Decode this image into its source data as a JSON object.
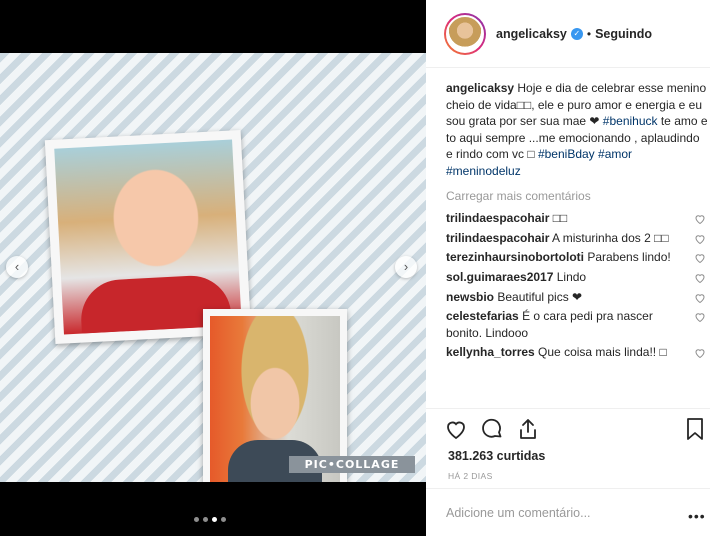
{
  "post": {
    "username": "angelicaksy",
    "verified": true,
    "follow_separator": "•",
    "follow_status": "Seguindo",
    "caption_text_before_tag": " Hoje e dia de celebrar esse menino cheio de vida□□, ele e puro amor e energia e eu sou grata por ser sua mae ❤ ",
    "caption_tag1": "#benihuck",
    "caption_mid": " te amo e to aqui sempre ...me emocionando , aplaudindo e rindo com vc □ ",
    "caption_tag2": "#beniBday",
    "caption_tag3": "#amor",
    "caption_tag4": "#meninodeluz",
    "load_more": "Carregar mais comentários",
    "likes": "381.263 curtidas",
    "time_ago": "HÁ 2 DIAS",
    "add_comment_placeholder": "Adicione um comentário...",
    "more_options": "•••"
  },
  "comments": [
    {
      "user": "trilindaespacohair",
      "text": " □□"
    },
    {
      "user": "trilindaespacohair",
      "text": " A misturinha dos 2 □□"
    },
    {
      "user": "terezinhaursinobortoloti",
      "text": " Parabens lindo!"
    },
    {
      "user": "sol.guimaraes2017",
      "text": " Lindo"
    },
    {
      "user": "newsbio",
      "text": " Beautiful pics ❤"
    },
    {
      "user": "celestefarias",
      "text": " É o cara pedi pra nascer bonito. Lindooo"
    },
    {
      "user": "kellynha_torres",
      "text": " Que coisa mais linda!! □"
    }
  ],
  "media": {
    "watermark": "PIC•COLLAGE",
    "prev_arrow": "‹",
    "next_arrow": "›",
    "slide_count": 4,
    "active_slide": 3
  },
  "colors": {
    "link": "#003569",
    "verified": "#3897f0",
    "stripe_dark": "#ccd9e1",
    "stripe_light": "#f1f5f7"
  }
}
